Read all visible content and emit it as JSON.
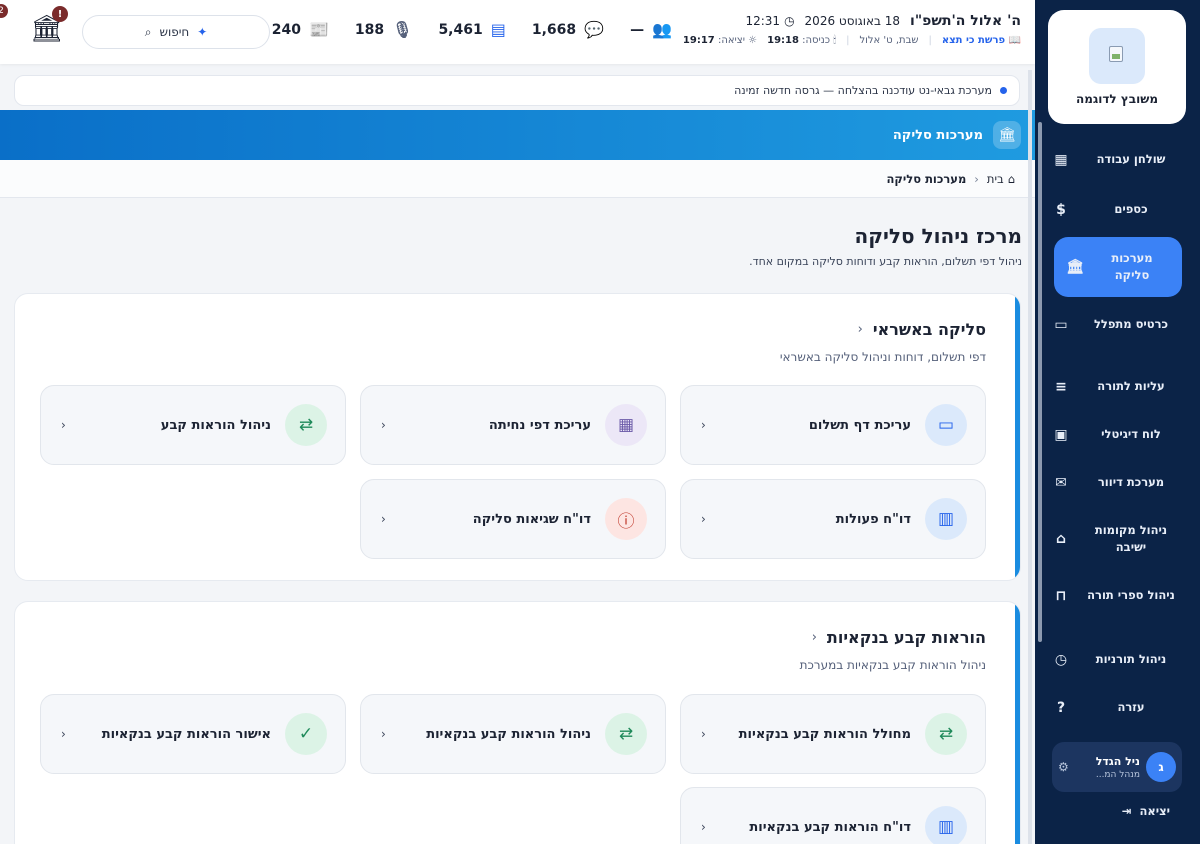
{
  "sidebar": {
    "logo_name": "משובץ לדוגמה",
    "items": [
      {
        "label": "שולחן עבודה",
        "icon": "dashboard-icon",
        "glyph": "▦"
      },
      {
        "label": "כספים",
        "icon": "dollar-icon",
        "glyph": "$"
      },
      {
        "label": "מערכות סליקה",
        "icon": "bank-icon",
        "glyph": "🏛"
      },
      {
        "label": "כרטיס מתפלל",
        "icon": "id-card-icon",
        "glyph": "▭"
      },
      {
        "label": "עליות לתורה",
        "icon": "scroll-icon",
        "glyph": "📜"
      },
      {
        "label": "לוח דיגיטלי",
        "icon": "monitor-icon",
        "glyph": "🖥"
      },
      {
        "label": "מערכת דיוור",
        "icon": "mail-icon",
        "glyph": "✉"
      },
      {
        "label": "ניהול מקומות ישיבה",
        "icon": "seat-icon",
        "glyph": "⌂"
      },
      {
        "label": "ניהול ספרי תורה",
        "icon": "book-icon",
        "glyph": "📖"
      },
      {
        "label": "ניהול תורניות",
        "icon": "calendar-clock-icon",
        "glyph": "📅"
      },
      {
        "label": "עזרה",
        "icon": "help-icon",
        "glyph": "?"
      }
    ],
    "user": {
      "initial": "ג",
      "name": "ניל הגדל",
      "role": "מנהל המ..."
    },
    "logout_label": "יציאה"
  },
  "topbar": {
    "hebrew_date": "ה' אלול ה'תשפ\"ו",
    "greg_date": "18 באוגוסט 2026",
    "time": "12:31",
    "parasha_label": "פרשת כי תצא",
    "shabbat_label": "שבת, ט' אלול",
    "candle_label": "כניסה:",
    "candle_time": "19:18",
    "exit_label": "יציאה:",
    "exit_time": "19:17",
    "stats": {
      "members_dash": "—",
      "chats": "1,668",
      "messages": "5,461",
      "voice": "188",
      "news": "240"
    },
    "search_label": "חיפוש",
    "bank_badge": "!",
    "corner_badge": "2"
  },
  "notice": "מערכת גבאי-נט עודכנה בהצלחה — גרסה חדשה זמינה",
  "band_title": "מערכות סליקה",
  "breadcrumb": {
    "home": "בית",
    "current": "מערכות סליקה"
  },
  "main": {
    "title": "מרכז ניהול סליקה",
    "subtitle": "ניהול דפי תשלום, הוראות קבע ודוחות סליקה במקום אחד."
  },
  "sections": [
    {
      "title": "סליקה באשראי",
      "subtitle": "דפי תשלום, דוחות וניהול סליקה באשראי",
      "cards": [
        {
          "label": "עריכת דף תשלום",
          "icon": "credit-card-icon"
        },
        {
          "label": "עריכת דפי נחיתה",
          "icon": "layout-icon"
        },
        {
          "label": "ניהול הוראות קבע",
          "icon": "repeat-icon"
        },
        {
          "label": "דו\"ח פעולות",
          "icon": "report-icon"
        },
        {
          "label": "דו\"ח שגיאות סליקה",
          "icon": "alert-icon"
        }
      ]
    },
    {
      "title": "הוראות קבע בנקאיות",
      "subtitle": "ניהול הוראות קבע בנקאיות במערכת",
      "cards": [
        {
          "label": "מחולל הוראות קבע בנקאיות",
          "icon": "repeat-icon"
        },
        {
          "label": "ניהול הוראות קבע בנקאיות",
          "icon": "repeat-icon"
        },
        {
          "label": "אישור הוראות קבע בנקאיות",
          "icon": "check-circle-icon"
        },
        {
          "label": "דו\"ח הוראות קבע בנקאיות",
          "icon": "report-icon"
        }
      ]
    }
  ]
}
